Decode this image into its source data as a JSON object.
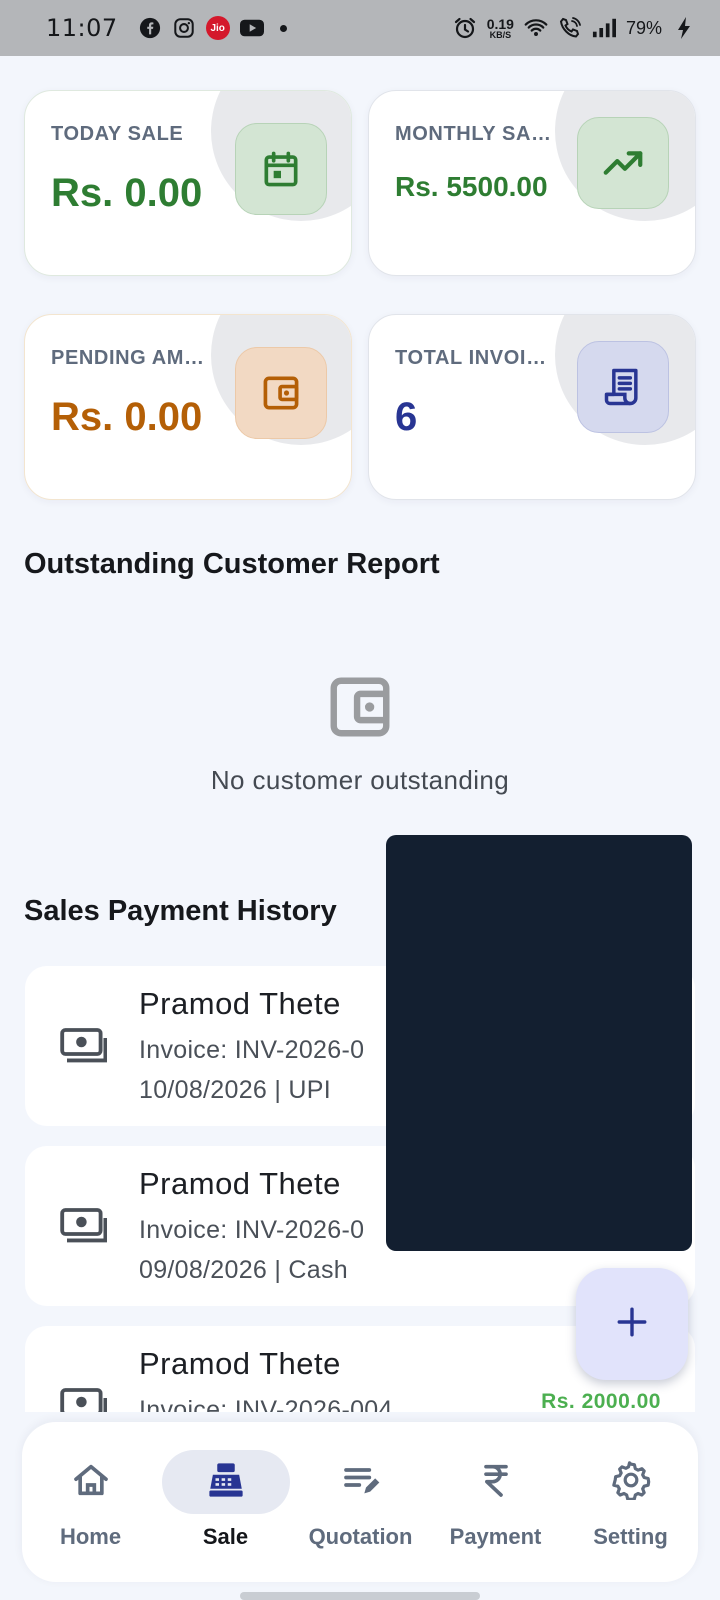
{
  "status_bar": {
    "time": "11:07",
    "net_speed": "0.19",
    "net_unit": "KB/S",
    "battery": "79%"
  },
  "stats": [
    {
      "label": "TODAY SALE",
      "value": "Rs. 0.00",
      "color": "#2e7d32",
      "icon": "calendar-icon"
    },
    {
      "label": "MONTHLY SALE",
      "value": "Rs. 5500.00",
      "color": "#2e7d32",
      "icon": "trending-up-icon"
    },
    {
      "label": "PENDING AMOUNT",
      "value": "Rs. 0.00",
      "color": "#b45f06",
      "icon": "wallet-icon"
    },
    {
      "label": "TOTAL INVOICES",
      "value": "6",
      "color": "#283593",
      "icon": "receipt-icon"
    }
  ],
  "outstanding": {
    "title": "Outstanding Customer Report",
    "empty_text": "No customer outstanding"
  },
  "history": {
    "title": "Sales Payment History",
    "items": [
      {
        "name": "Pramod Thete",
        "invoice": "Invoice: INV-2026-0",
        "meta": "10/08/2026 | UPI",
        "amount": ""
      },
      {
        "name": "Pramod Thete",
        "invoice": "Invoice: INV-2026-0",
        "meta": "09/08/2026 | Cash",
        "amount": ""
      },
      {
        "name": "Pramod Thete",
        "invoice": "Invoice: INV-2026-004",
        "meta": "",
        "amount": "Rs. 2000.00"
      }
    ]
  },
  "nav": [
    {
      "label": "Home",
      "icon": "home-icon",
      "active": false
    },
    {
      "label": "Sale",
      "icon": "cash-register-icon",
      "active": true
    },
    {
      "label": "Quotation",
      "icon": "edit-note-icon",
      "active": false
    },
    {
      "label": "Payment",
      "icon": "rupee-icon",
      "active": false
    },
    {
      "label": "Setting",
      "icon": "gear-icon",
      "active": false
    }
  ]
}
